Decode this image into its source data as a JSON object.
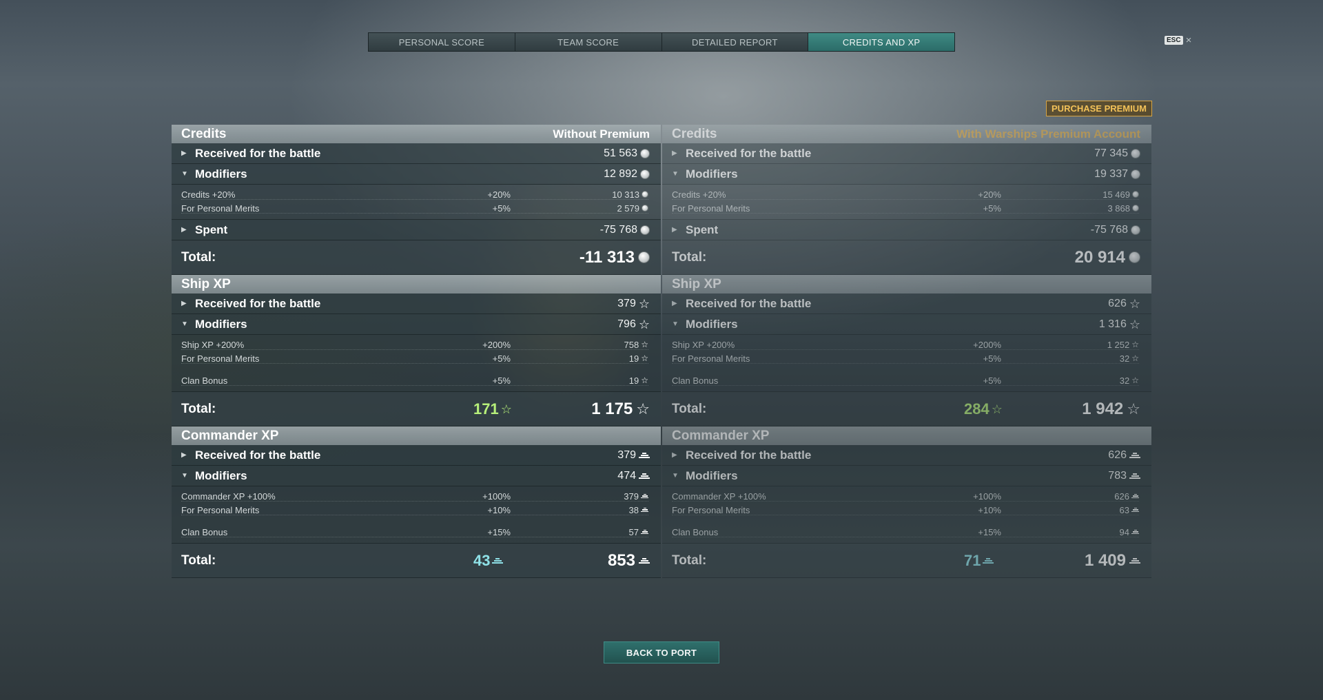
{
  "tabs": [
    {
      "label": "PERSONAL SCORE"
    },
    {
      "label": "TEAM SCORE"
    },
    {
      "label": "DETAILED REPORT"
    },
    {
      "label": "CREDITS AND XP"
    }
  ],
  "esc": {
    "key": "ESC",
    "close": "×"
  },
  "purchase_premium": "PURCHASE PREMIUM",
  "back_to_port": "BACK TO PORT",
  "colors": {
    "accent": "#2b6c68",
    "premium": "#e5b24e",
    "bonus_green": "#b7f07a",
    "bonus_cyan": "#8fe2e8"
  },
  "columns": [
    {
      "credits": {
        "title": "Credits",
        "subtitle": "Without Premium",
        "received_label": "Received for the battle",
        "received": "51 563",
        "modifiers_label": "Modifiers",
        "modifiers": "12 892",
        "details": [
          {
            "label": "Credits +20%",
            "pct": "+20%",
            "value": "10 313"
          },
          {
            "label": "For Personal Merits",
            "pct": "+5%",
            "value": "2 579"
          }
        ],
        "spent_label": "Spent",
        "spent": "-75 768",
        "total_label": "Total:",
        "total": "-11 313"
      },
      "ship_xp": {
        "title": "Ship XP",
        "received_label": "Received for the battle",
        "received": "379",
        "modifiers_label": "Modifiers",
        "modifiers": "796",
        "details": [
          {
            "label": "Ship XP +200%",
            "pct": "+200%",
            "value": "758"
          },
          {
            "label": "For Personal Merits",
            "pct": "+5%",
            "value": "19"
          },
          {
            "label": "Clan Bonus",
            "pct": "+5%",
            "value": "19"
          }
        ],
        "total_label": "Total:",
        "bonus": "171",
        "total": "1 175"
      },
      "commander_xp": {
        "title": "Commander XP",
        "received_label": "Received for the battle",
        "received": "379",
        "modifiers_label": "Modifiers",
        "modifiers": "474",
        "details": [
          {
            "label": "Commander XP +100%",
            "pct": "+100%",
            "value": "379"
          },
          {
            "label": "For Personal Merits",
            "pct": "+10%",
            "value": "38"
          },
          {
            "label": "Clan Bonus",
            "pct": "+15%",
            "value": "57"
          }
        ],
        "total_label": "Total:",
        "bonus": "43",
        "total": "853"
      }
    },
    {
      "credits": {
        "title": "Credits",
        "subtitle": "With Warships Premium Account",
        "received_label": "Received for the battle",
        "received": "77 345",
        "modifiers_label": "Modifiers",
        "modifiers": "19 337",
        "details": [
          {
            "label": "Credits +20%",
            "pct": "+20%",
            "value": "15 469"
          },
          {
            "label": "For Personal Merits",
            "pct": "+5%",
            "value": "3 868"
          }
        ],
        "spent_label": "Spent",
        "spent": "-75 768",
        "total_label": "Total:",
        "total": "20 914"
      },
      "ship_xp": {
        "title": "Ship XP",
        "received_label": "Received for the battle",
        "received": "626",
        "modifiers_label": "Modifiers",
        "modifiers": "1 316",
        "details": [
          {
            "label": "Ship XP +200%",
            "pct": "+200%",
            "value": "1 252"
          },
          {
            "label": "For Personal Merits",
            "pct": "+5%",
            "value": "32"
          },
          {
            "label": "Clan Bonus",
            "pct": "+5%",
            "value": "32"
          }
        ],
        "total_label": "Total:",
        "bonus": "284",
        "total": "1 942"
      },
      "commander_xp": {
        "title": "Commander XP",
        "received_label": "Received for the battle",
        "received": "626",
        "modifiers_label": "Modifiers",
        "modifiers": "783",
        "details": [
          {
            "label": "Commander XP +100%",
            "pct": "+100%",
            "value": "626"
          },
          {
            "label": "For Personal Merits",
            "pct": "+10%",
            "value": "63"
          },
          {
            "label": "Clan Bonus",
            "pct": "+15%",
            "value": "94"
          }
        ],
        "total_label": "Total:",
        "bonus": "71",
        "total": "1 409"
      }
    }
  ]
}
